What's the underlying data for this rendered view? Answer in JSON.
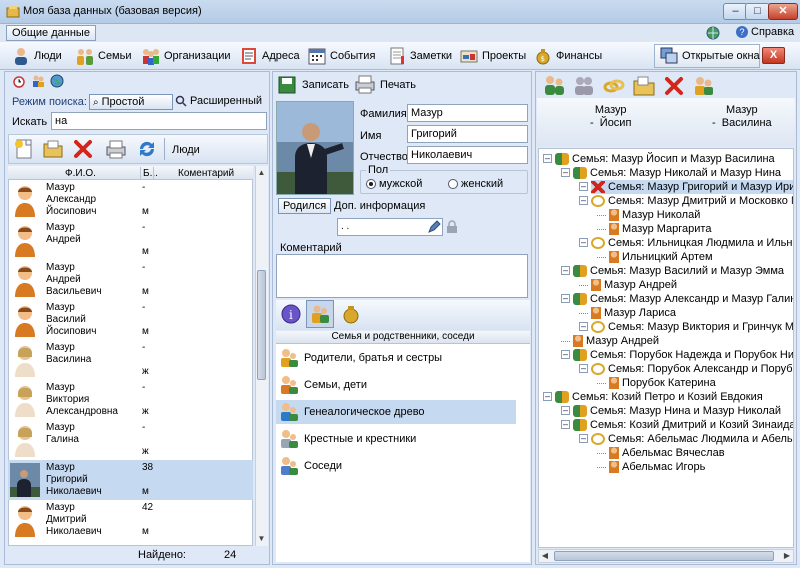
{
  "window": {
    "title": "Моя база данных (базовая версия)",
    "minimize": "–",
    "maximize": "□",
    "close": "✕"
  },
  "menu": {
    "general_data": "Общие данные",
    "help": "Справка"
  },
  "toolbar": {
    "items": [
      "Люди",
      "Семьи",
      "Организации",
      "Адреса",
      "События",
      "Заметки",
      "Проекты",
      "Финансы"
    ],
    "open_windows": "Открытые окна",
    "close": "X"
  },
  "search": {
    "mode_label": "Режим поиска:",
    "mode_simple": "Простой",
    "mode_advanced": "Расширенный",
    "search_label": "Искать",
    "search_value": "на"
  },
  "people": {
    "section_label": "Люди",
    "col_fio": "Ф.И.О.",
    "col_b": "Б...",
    "col_comment": "Коментарий",
    "found_label": "Найдено:",
    "found_count": "24",
    "rows": [
      {
        "name": [
          "Мазур",
          "Александр",
          "Йосипович"
        ],
        "c1": "-",
        "sex": "м",
        "gender": "male"
      },
      {
        "name": [
          "Мазур",
          "Андрей",
          ""
        ],
        "c1": "-",
        "sex": "м",
        "gender": "male"
      },
      {
        "name": [
          "Мазур",
          "Андрей",
          "Васильевич"
        ],
        "c1": "-",
        "sex": "м",
        "gender": "male"
      },
      {
        "name": [
          "Мазур",
          "Василий",
          "Йосипович"
        ],
        "c1": "-",
        "sex": "м",
        "gender": "male"
      },
      {
        "name": [
          "Мазур",
          "Василина",
          ""
        ],
        "c1": "-",
        "sex": "ж",
        "gender": "female"
      },
      {
        "name": [
          "Мазур",
          "Виктория",
          "Александровна"
        ],
        "c1": "-",
        "sex": "ж",
        "gender": "female"
      },
      {
        "name": [
          "Мазур",
          "Галина",
          ""
        ],
        "c1": "-",
        "sex": "ж",
        "gender": "female"
      },
      {
        "name": [
          "Мазур",
          "Григорий",
          "Николаевич"
        ],
        "c1": "38",
        "sex": "м",
        "gender": "photo"
      },
      {
        "name": [
          "Мазур",
          "Дмитрий",
          "Николаевич"
        ],
        "c1": "42",
        "sex": "м",
        "gender": "male"
      }
    ]
  },
  "person": {
    "save": "Записать",
    "print": "Печать",
    "surname_label": "Фамилия",
    "surname": "Мазур",
    "name_label": "Имя",
    "name": "Григорий",
    "patronymic_label": "Отчество",
    "patronymic": "Николаевич",
    "sex_label": "Пол",
    "male": "мужской",
    "female": "женский",
    "tab_born": "Родился",
    "tab_extra": "Доп. информация",
    "date_value": " .  .",
    "comment_label": "Коментарий",
    "relatives_header": "Семья и родственники, соседи",
    "relatives": [
      "Родители, братья и сестры",
      "Семьи, дети",
      "Генеалогическое древо",
      "Крестные и крестники",
      "Соседи"
    ]
  },
  "family_tree": {
    "head_left": [
      "Мазур",
      "Йосип"
    ],
    "head_right": [
      "Мазур",
      "Василина"
    ],
    "nodes": [
      {
        "level": 0,
        "text": "Семья: Мазур Йосип и Мазур Василина",
        "icon": "family"
      },
      {
        "level": 1,
        "text": "Семья: Мазур Николай и Мазур Нина",
        "icon": "family"
      },
      {
        "level": 2,
        "text": "Семья: Мазур Григорий и Мазур Ирина",
        "icon": "cross",
        "hl": true
      },
      {
        "level": 2,
        "text": "Семья: Мазур Дмитрий и Московко Марина",
        "icon": "ring"
      },
      {
        "level": 3,
        "text": "Мазур Николай",
        "icon": "person"
      },
      {
        "level": 3,
        "text": "Мазур Маргарита",
        "icon": "person"
      },
      {
        "level": 2,
        "text": "Семья: Ильницкая Людмила и Ильницкий",
        "icon": "ring"
      },
      {
        "level": 3,
        "text": "Ильницкий Артем",
        "icon": "person"
      },
      {
        "level": 1,
        "text": "Семья: Мазур Василий и Мазур Эмма",
        "icon": "family"
      },
      {
        "level": 2,
        "text": "Мазур Андрей",
        "icon": "person"
      },
      {
        "level": 1,
        "text": "Семья: Мазур Александр и Мазур Галина",
        "icon": "family"
      },
      {
        "level": 2,
        "text": "Мазур Лариса",
        "icon": "person"
      },
      {
        "level": 2,
        "text": "Семья: Мазур Виктория и Гринчук Мирон",
        "icon": "ring"
      },
      {
        "level": 1,
        "text": "Мазур Андрей",
        "icon": "person"
      },
      {
        "level": 1,
        "text": "Семья: Порубок Надежда и Порубок Николай",
        "icon": "family"
      },
      {
        "level": 2,
        "text": "Семья: Порубок Александр и Порубок",
        "icon": "ring"
      },
      {
        "level": 3,
        "text": "Порубок Катерина",
        "icon": "person"
      },
      {
        "level": 0,
        "text": "Семья: Козий Петро и Козий Евдокия",
        "icon": "family"
      },
      {
        "level": 1,
        "text": "Семья: Мазур Нина и Мазур Николай",
        "icon": "family"
      },
      {
        "level": 1,
        "text": "Семья: Козий Дмитрий и Козий Зинаида",
        "icon": "family"
      },
      {
        "level": 2,
        "text": "Семья: Абельмас Людмила и Абельмас",
        "icon": "ring"
      },
      {
        "level": 3,
        "text": "Абельмас Вячеслав",
        "icon": "person"
      },
      {
        "level": 3,
        "text": "Абельмас Игорь",
        "icon": "person"
      }
    ]
  },
  "colors": {
    "accent": "#3c6fc5",
    "selection": "#c5d9f1",
    "window_bg": "#dfe8f6"
  }
}
